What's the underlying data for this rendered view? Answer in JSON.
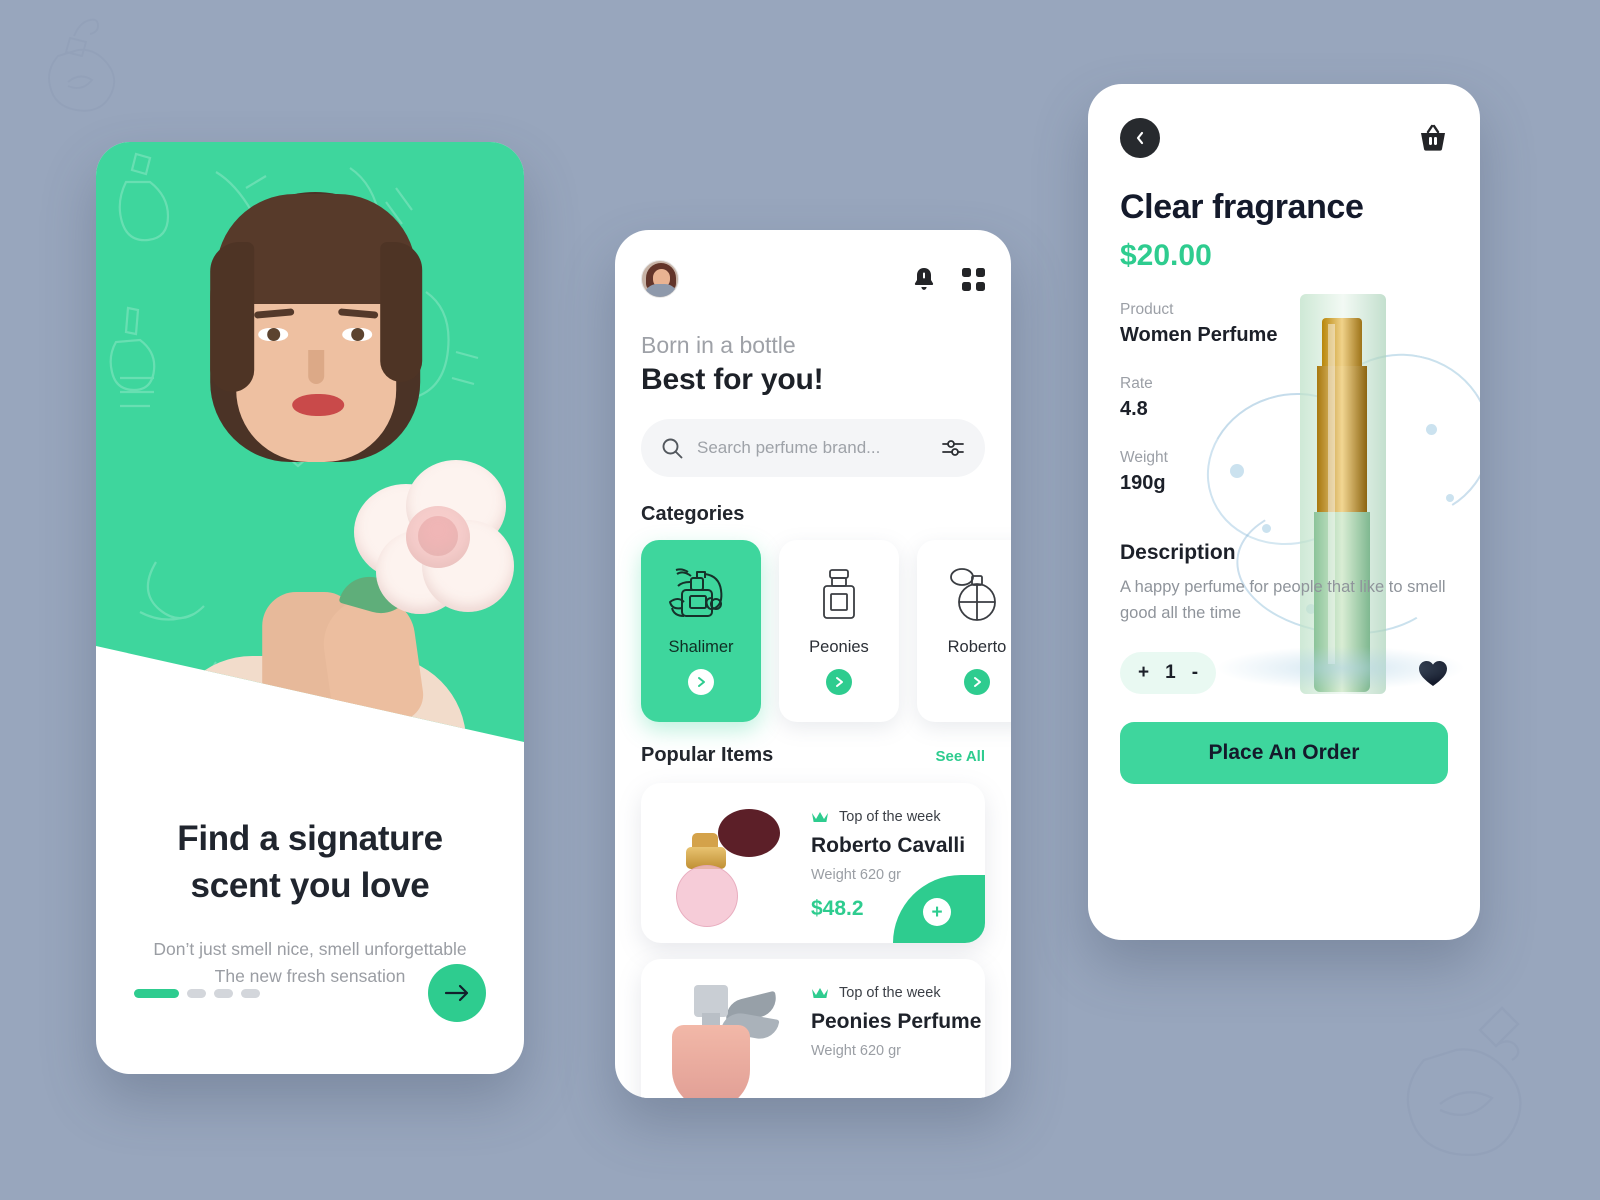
{
  "theme": {
    "page_background": "#98a6bd",
    "accent_green": "#2ecc8f",
    "hero_green": "#3ed69d",
    "dark_text": "#1d2128",
    "muted_text": "#9a9ea4"
  },
  "screen1": {
    "title": "Find a signature scent you love",
    "subtitle_line1": "Don’t just smell nice, smell unforgettable",
    "subtitle_line2": "The new fresh sensation",
    "pagination": {
      "total": 4,
      "active_index": 0
    },
    "next_icon": "arrow-right-icon"
  },
  "screen2": {
    "avatar": "user-avatar",
    "bell_icon": "notification-bell-icon",
    "grid_icon": "grid-menu-icon",
    "kicker": "Born in a bottle",
    "heading": "Best for you!",
    "search": {
      "placeholder": "Search perfume brand...",
      "value": "",
      "search_icon": "search-icon",
      "filter_icon": "filter-sliders-icon"
    },
    "categories_title": "Categories",
    "categories": [
      {
        "label": "Shalimer",
        "icon": "perfume-spray-bottle-icon",
        "selected": true
      },
      {
        "label": "Peonies",
        "icon": "square-perfume-bottle-icon",
        "selected": false
      },
      {
        "label": "Roberto",
        "icon": "round-atomizer-bottle-icon",
        "selected": false
      }
    ],
    "popular_title": "Popular Items",
    "see_all": "See All",
    "products": [
      {
        "badge": "Top of the week",
        "badge_icon": "crown-icon",
        "name": "Roberto Cavalli",
        "weight": "Weight 620 gr",
        "price": "$48.2",
        "add_icon": "plus-icon"
      },
      {
        "badge": "Top of the week",
        "badge_icon": "crown-icon",
        "name": "Peonies Perfume",
        "weight": "Weight 620 gr",
        "price": "",
        "add_icon": "plus-icon"
      }
    ]
  },
  "screen3": {
    "back_icon": "chevron-left-icon",
    "cart_icon": "shopping-basket-icon",
    "title": "Clear fragrance",
    "price": "$20.00",
    "specs": [
      {
        "label": "Product",
        "value": "Women Perfume"
      },
      {
        "label": "Rate",
        "value": "4.8"
      },
      {
        "label": "Weight",
        "value": "190g"
      }
    ],
    "description_title": "Description",
    "description": "A happy perfume for people that like to smell good all the time",
    "stepper": {
      "increment": "+",
      "quantity": "1",
      "decrement": "-"
    },
    "favorite_icon": "heart-filled-icon",
    "order_button": "Place An Order"
  }
}
